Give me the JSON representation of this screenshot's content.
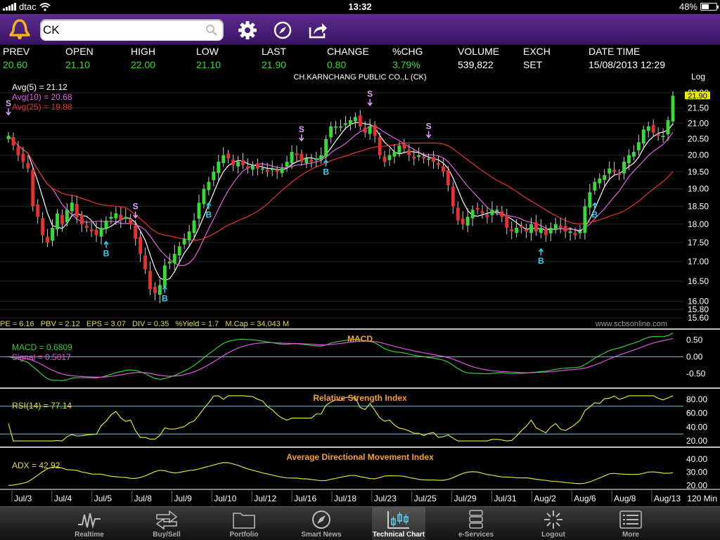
{
  "status_bar": {
    "carrier": "dtac",
    "time": "13:32",
    "battery": "48%"
  },
  "toolbar": {
    "search_value": "CK",
    "icons": [
      "app-logo-icon",
      "search-icon",
      "gear-icon",
      "compass-icon",
      "share-icon"
    ]
  },
  "quote": {
    "columns": [
      {
        "label": "PREV",
        "value": "20.60",
        "color": "#33dd33"
      },
      {
        "label": "OPEN",
        "value": "21.10",
        "color": "#33dd33"
      },
      {
        "label": "HIGH",
        "value": "22.00",
        "color": "#33dd33"
      },
      {
        "label": "LOW",
        "value": "21.10",
        "color": "#33dd33"
      },
      {
        "label": "LAST",
        "value": "21.90",
        "color": "#33dd33"
      },
      {
        "label": "CHANGE",
        "value": "0.80",
        "color": "#33dd33"
      },
      {
        "label": "%CHG",
        "value": "3.79%",
        "color": "#33dd33"
      },
      {
        "label": "VOLUME",
        "value": "539,822",
        "color": "#ffffff"
      },
      {
        "label": "EXCH",
        "value": "SET",
        "color": "#ffffff"
      },
      {
        "label": "DATE TIME",
        "value": "15/08/2013 12:29",
        "color": "#ffffff"
      }
    ]
  },
  "price_chart": {
    "title": "CH.KARNCHANG PUBLIC CO.,L (CK)",
    "scale_label": "Log",
    "last_price_badge": "21.90",
    "avg_legend": [
      {
        "label": "Avg(5)",
        "value": "= 21.12",
        "color": "#ffffff"
      },
      {
        "label": "Avg(10)",
        "value": "= 20.68",
        "color": "#e060e0"
      },
      {
        "label": "Avg(25)",
        "value": "= 19.88",
        "color": "#e83030"
      }
    ],
    "y_ticks": [
      22.0,
      21.5,
      21.0,
      20.5,
      20.0,
      19.5,
      19.0,
      18.5,
      18.0,
      17.5,
      17.0,
      16.5,
      16.0,
      15.8,
      15.6
    ],
    "y_tick_labels": [
      "22.00",
      "21.50",
      "21.00",
      "20.50",
      "20.00",
      "19.50",
      "19.00",
      "18.50",
      "18.00",
      "17.50",
      "17.00",
      "16.50",
      "16.00",
      "15.80",
      "15.60"
    ],
    "fundamentals": "PE = 6.16   PBV = 2.12   EPS = 3.07   DIV = 0.35   %Yield = 1.7   M.Cap = 34,043 M",
    "watermark": "www.scbsonline.com",
    "buy_label": "B",
    "sell_label": "S",
    "signals": [
      {
        "type": "S",
        "index": 0
      },
      {
        "type": "B",
        "index": 20
      },
      {
        "type": "S",
        "index": 26
      },
      {
        "type": "B",
        "index": 32
      },
      {
        "type": "B",
        "index": 41
      },
      {
        "type": "S",
        "index": 60
      },
      {
        "type": "B",
        "index": 65
      },
      {
        "type": "S",
        "index": 74
      },
      {
        "type": "S",
        "index": 86
      },
      {
        "type": "B",
        "index": 109
      },
      {
        "type": "B",
        "index": 120
      }
    ]
  },
  "chart_data": [
    {
      "type": "candlestick",
      "title": "CH.KARNCHANG PUBLIC CO.,L (CK)",
      "interval": "120 Min",
      "ylim": [
        15.6,
        22.0
      ],
      "y_scale": "log",
      "close": [
        20.6,
        20.3,
        20.0,
        19.8,
        19.6,
        18.5,
        18.2,
        17.7,
        17.5,
        17.9,
        18.3,
        18.0,
        18.4,
        18.6,
        18.2,
        18.0,
        17.9,
        17.8,
        17.7,
        17.9,
        18.1,
        18.2,
        18.3,
        18.1,
        18.2,
        18.0,
        17.6,
        17.2,
        16.8,
        16.3,
        16.2,
        16.4,
        16.9,
        17.0,
        17.2,
        17.4,
        17.6,
        17.8,
        18.1,
        18.6,
        19.0,
        19.2,
        19.5,
        19.8,
        20.0,
        19.9,
        19.7,
        19.8,
        19.7,
        19.6,
        19.7,
        19.6,
        19.6,
        19.5,
        19.6,
        19.5,
        19.6,
        19.8,
        20.1,
        20.0,
        19.8,
        19.9,
        19.8,
        19.9,
        20.0,
        20.5,
        20.9,
        20.9,
        20.9,
        21.0,
        21.1,
        21.2,
        20.9,
        20.7,
        20.9,
        20.6,
        20.0,
        19.8,
        20.0,
        20.1,
        20.3,
        20.2,
        20.0,
        19.9,
        20.0,
        19.9,
        19.9,
        19.8,
        19.7,
        19.5,
        19.1,
        18.5,
        18.1,
        18.0,
        18.2,
        18.4,
        18.4,
        18.3,
        18.2,
        18.4,
        18.4,
        18.2,
        17.9,
        17.8,
        17.9,
        17.9,
        17.8,
        18.0,
        17.8,
        17.9,
        17.7,
        17.9,
        18.0,
        17.9,
        17.8,
        17.8,
        17.7,
        17.8,
        18.5,
        18.9,
        19.2,
        19.3,
        19.4,
        19.6,
        19.5,
        19.4,
        19.8,
        20.0,
        20.1,
        20.4,
        20.8,
        20.9,
        20.7,
        20.6,
        20.6,
        21.1,
        21.9
      ],
      "series": [
        {
          "name": "Avg(5)",
          "last": 21.12
        },
        {
          "name": "Avg(10)",
          "last": 20.68
        },
        {
          "name": "Avg(25)",
          "last": 19.88
        }
      ],
      "x_tick_labels": [
        "Jul/3",
        "Jul/4",
        "Jul/5",
        "Jul/8",
        "Jul/9",
        "Jul/10",
        "Jul/12",
        "Jul/16",
        "Jul/18",
        "Jul/23",
        "Jul/25",
        "Jul/29",
        "Jul/31",
        "Aug/2",
        "Aug/6",
        "Aug/8",
        "Aug/13"
      ]
    },
    {
      "type": "line",
      "title": "MACD",
      "ylim": [
        -0.85,
        0.7
      ],
      "y_ticks": [
        0.5,
        0.0,
        -0.5
      ],
      "y_tick_labels": [
        "0.50",
        "0.00",
        "-0.50"
      ],
      "series": [
        {
          "name": "MACD",
          "label_value": "= 0.6809",
          "color": "#33cc33"
        },
        {
          "name": "Signal",
          "label_value": "= 0.5017",
          "color": "#dd55dd"
        }
      ]
    },
    {
      "type": "line",
      "title": "Relative Strength Index",
      "ylim": [
        15,
        90
      ],
      "y_ticks": [
        80,
        60,
        40,
        20
      ],
      "y_tick_labels": [
        "80.00",
        "60.00",
        "40.00",
        "20.00"
      ],
      "guides": [
        70,
        30
      ],
      "series": [
        {
          "name": "RSI(14)",
          "label_value": "= 77.14",
          "color": "#dddd33"
        }
      ]
    },
    {
      "type": "line",
      "title": "Average Directional Movement Index",
      "ylim": [
        18,
        46
      ],
      "y_ticks": [
        40,
        30,
        20
      ],
      "y_tick_labels": [
        "40.00",
        "30.00",
        "20.00"
      ],
      "series": [
        {
          "name": "ADX",
          "label_value": "= 42.92",
          "color": "#dddd33"
        }
      ]
    }
  ],
  "tabs": [
    {
      "label": "Realtime",
      "icon": "pulse-icon",
      "active": false
    },
    {
      "label": "Buy/Sell",
      "icon": "arrows-icon",
      "active": false
    },
    {
      "label": "Portfolio",
      "icon": "folder-icon",
      "active": false
    },
    {
      "label": "Smart News",
      "icon": "compass-icon",
      "active": false
    },
    {
      "label": "Technical Chart",
      "icon": "candle-chart-icon",
      "active": true
    },
    {
      "label": "e-Services",
      "icon": "server-icon",
      "active": false
    },
    {
      "label": "Logout",
      "icon": "logout-icon",
      "active": false
    },
    {
      "label": "More",
      "icon": "list-icon",
      "active": false
    }
  ]
}
